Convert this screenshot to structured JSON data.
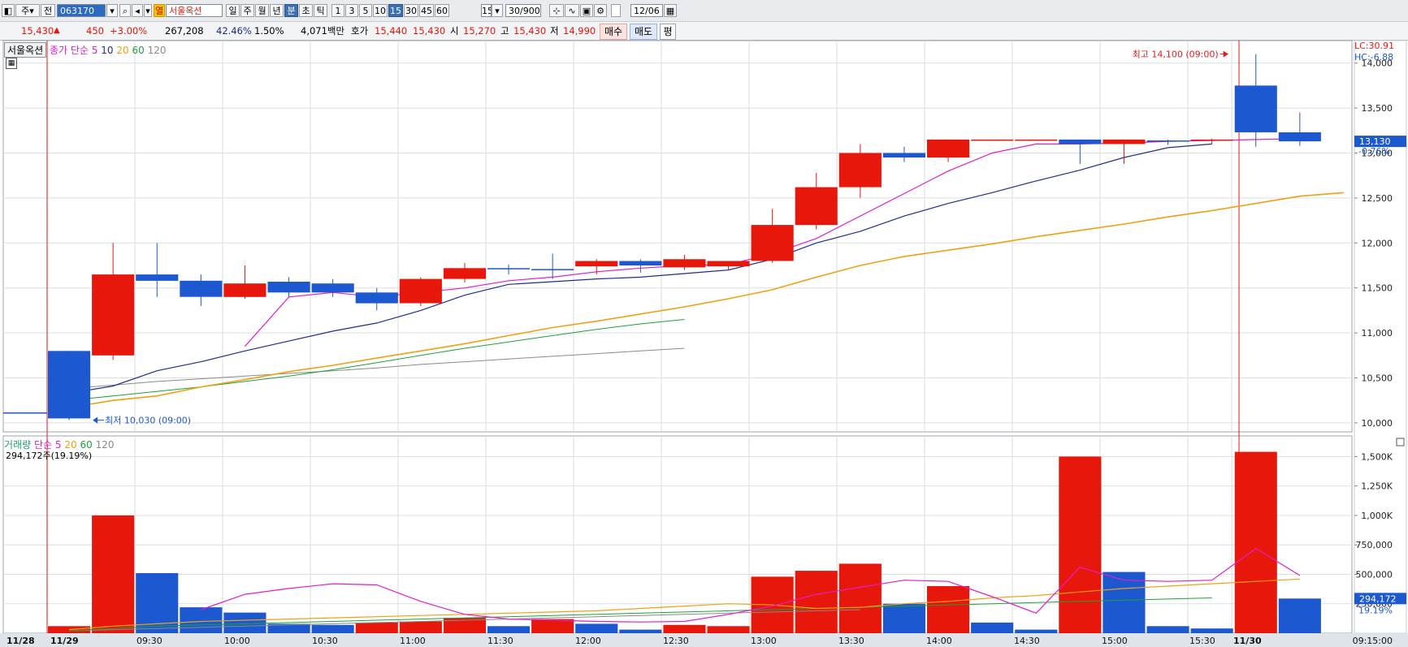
{
  "toolbar": {
    "market_btn": "주",
    "mode_btn": "전",
    "code_value": "063170",
    "name_tag": "열",
    "stock_name": "서울옥션",
    "period_tabs": [
      "일",
      "주",
      "월",
      "년",
      "분",
      "초",
      "틱"
    ],
    "period_selected": "분",
    "minute_tabs": [
      "1",
      "3",
      "5",
      "10",
      "15",
      "30",
      "45",
      "60"
    ],
    "minute_selected": "15",
    "minute_value": "15",
    "count_value": "30/900",
    "date_value": "12/06"
  },
  "quote": {
    "price": "15,430",
    "change_arrow": "▲",
    "change": "450",
    "change_pct": "+3.00%",
    "volume": "267,208",
    "vol_ratio": "42.46%",
    "turnover": "1.50%",
    "amount": "4,071백만",
    "hoga_label": "호가",
    "ask": "15,440",
    "bid": "15,430",
    "open_label": "시",
    "open": "15,270",
    "high_label": "고",
    "high": "15,430",
    "low_label": "저",
    "low": "14,990",
    "buy_btn": "매수",
    "sell_btn": "매도",
    "avg_btn": "평"
  },
  "price_legend": {
    "name": "서울옥션",
    "ma_label": "종가 단순",
    "periods": [
      "5",
      "10",
      "20",
      "60",
      "120"
    ]
  },
  "volume_legend": {
    "name": "거래량",
    "ma_label": "단순",
    "periods": [
      "5",
      "20",
      "60",
      "120"
    ],
    "current": "294,172주(19.19%)"
  },
  "annotations": {
    "high_text": "최고 14,100 (09:00)",
    "low_text": "최저 10,030 (09:00)",
    "lc": "LC:30.91",
    "hc": "HC:-6.88",
    "last_price": "13,130",
    "last_pct": "-0.76%",
    "last_volume": "294,172",
    "last_vol_pct": "19.19%"
  },
  "colors": {
    "up": "#e8170b",
    "down": "#1c58cf",
    "ma5": "#e21ec8",
    "ma10": "#1f2e8c",
    "ma20": "#f0a015",
    "ma60": "#1fa03a",
    "ma120": "#8a8a8a",
    "marker": "#e21a1a"
  },
  "chart_data": [
    {
      "type": "candlestick",
      "title": "서울옥션 15분",
      "x_labels": [
        "11/28",
        "11/29",
        "09:30",
        "10:00",
        "10:30",
        "11:00",
        "11:30",
        "12:00",
        "12:30",
        "13:00",
        "13:30",
        "14:00",
        "14:30",
        "15:00",
        "15:30",
        "11/30",
        "09:15:00"
      ],
      "y_ticks": [
        "10,000",
        "10,500",
        "11,000",
        "11,500",
        "12,000",
        "12,500",
        "13,000",
        "13,500",
        "14,000"
      ],
      "ylim": [
        9900,
        14250
      ],
      "candles": [
        {
          "o": 10800,
          "h": 10800,
          "l": 10030,
          "c": 10050
        },
        {
          "o": 10750,
          "h": 12000,
          "l": 10700,
          "c": 11650
        },
        {
          "o": 11650,
          "h": 12000,
          "l": 11400,
          "c": 11580
        },
        {
          "o": 11580,
          "h": 11650,
          "l": 11300,
          "c": 11400
        },
        {
          "o": 11400,
          "h": 11750,
          "l": 11380,
          "c": 11550
        },
        {
          "o": 11570,
          "h": 11620,
          "l": 11400,
          "c": 11450
        },
        {
          "o": 11550,
          "h": 11600,
          "l": 11400,
          "c": 11450
        },
        {
          "o": 11450,
          "h": 11500,
          "l": 11250,
          "c": 11330
        },
        {
          "o": 11330,
          "h": 11620,
          "l": 11300,
          "c": 11600
        },
        {
          "o": 11600,
          "h": 11780,
          "l": 11560,
          "c": 11720
        },
        {
          "o": 11720,
          "h": 11760,
          "l": 11650,
          "c": 11710
        },
        {
          "o": 11710,
          "h": 11880,
          "l": 11600,
          "c": 11700
        },
        {
          "o": 11740,
          "h": 11820,
          "l": 11650,
          "c": 11800
        },
        {
          "o": 11800,
          "h": 11820,
          "l": 11670,
          "c": 11750
        },
        {
          "o": 11730,
          "h": 11870,
          "l": 11700,
          "c": 11820
        },
        {
          "o": 11740,
          "h": 11800,
          "l": 11700,
          "c": 11800
        },
        {
          "o": 11800,
          "h": 12380,
          "l": 11780,
          "c": 12200
        },
        {
          "o": 12200,
          "h": 12780,
          "l": 12150,
          "c": 12620
        },
        {
          "o": 12620,
          "h": 13100,
          "l": 12500,
          "c": 13000
        },
        {
          "o": 13000,
          "h": 13070,
          "l": 12900,
          "c": 12950
        },
        {
          "o": 12950,
          "h": 13150,
          "l": 12900,
          "c": 13150
        },
        {
          "o": 13150,
          "h": 13150,
          "l": 13150,
          "c": 13150
        },
        {
          "o": 13150,
          "h": 13150,
          "l": 13150,
          "c": 13150
        },
        {
          "o": 13150,
          "h": 13150,
          "l": 12880,
          "c": 13100
        },
        {
          "o": 13100,
          "h": 13150,
          "l": 12880,
          "c": 13150
        },
        {
          "o": 13140,
          "h": 13150,
          "l": 13090,
          "c": 13130
        },
        {
          "o": 13140,
          "h": 13160,
          "l": 13100,
          "c": 13150
        },
        {
          "o": 13750,
          "h": 14100,
          "l": 13070,
          "c": 13230
        },
        {
          "o": 13230,
          "h": 13450,
          "l": 13080,
          "c": 13130
        }
      ],
      "ma5": [
        null,
        null,
        null,
        null,
        10850,
        11400,
        11450,
        11400,
        11450,
        11500,
        11580,
        11620,
        11680,
        11720,
        11750,
        11760,
        11880,
        12050,
        12300,
        12550,
        12800,
        13000,
        13100,
        13100,
        13110,
        13130,
        13140,
        13150,
        13160
      ],
      "ma10": [
        10330,
        10410,
        10580,
        10680,
        10800,
        10910,
        11020,
        11110,
        11250,
        11420,
        11540,
        11570,
        11600,
        11620,
        11660,
        11700,
        11820,
        12000,
        12130,
        12300,
        12440,
        12560,
        12690,
        12810,
        12950,
        13060,
        13100
      ],
      "ma20": [
        10170,
        10250,
        10300,
        10400,
        10480,
        10570,
        10640,
        10720,
        10800,
        10880,
        10970,
        11060,
        11130,
        11210,
        11290,
        11380,
        11480,
        11620,
        11750,
        11850,
        11920,
        11990,
        12070,
        12140,
        12210,
        12290,
        12360,
        12440,
        12520,
        12560
      ],
      "ma60": [
        10250,
        10300,
        10350,
        10400,
        10460,
        10520,
        10590,
        10670,
        10750,
        10830,
        10900,
        10970,
        11040,
        11100,
        11150
      ],
      "ma120": [
        10380,
        10420,
        10460,
        10490,
        10520,
        10550,
        10580,
        10610,
        10650,
        10680,
        10710,
        10740,
        10770,
        10800,
        10830
      ]
    },
    {
      "type": "bar",
      "title": "거래량",
      "y_ticks": [
        "250,000",
        "500,000",
        "750,000",
        "1,000K",
        "1,250K",
        "1,500K"
      ],
      "ylim": [
        0,
        1620000
      ],
      "values": [
        60000,
        1000000,
        510000,
        220000,
        175000,
        80000,
        70000,
        90000,
        100000,
        130000,
        60000,
        120000,
        80000,
        30000,
        70000,
        60000,
        480000,
        530000,
        590000,
        250000,
        400000,
        90000,
        30000,
        1500000,
        520000,
        60000,
        40000,
        1540000,
        294172
      ],
      "up": [
        true,
        true,
        false,
        false,
        false,
        false,
        false,
        true,
        true,
        true,
        false,
        true,
        false,
        false,
        true,
        true,
        true,
        true,
        true,
        false,
        true,
        false,
        false,
        true,
        false,
        false,
        false,
        true,
        false
      ],
      "ma5": [
        null,
        null,
        null,
        200000,
        330000,
        380000,
        420000,
        410000,
        270000,
        160000,
        120000,
        110000,
        100000,
        95000,
        100000,
        160000,
        230000,
        330000,
        390000,
        450000,
        440000,
        310000,
        170000,
        560000,
        450000,
        440000,
        450000,
        720000,
        490000
      ],
      "ma20": [
        30000,
        60000,
        80000,
        100000,
        110000,
        120000,
        130000,
        140000,
        150000,
        160000,
        170000,
        180000,
        190000,
        210000,
        230000,
        250000,
        240000,
        210000,
        220000,
        250000,
        270000,
        300000,
        320000,
        350000,
        380000,
        400000,
        420000,
        440000,
        460000
      ],
      "ma60": [
        20000,
        40000,
        60000,
        70000,
        80000,
        90000,
        100000,
        110000,
        120000,
        130000,
        140000,
        150000,
        160000,
        170000,
        180000,
        190000,
        200000,
        210000,
        220000,
        230000,
        240000,
        250000,
        260000,
        270000,
        280000,
        290000,
        300000
      ],
      "ma120": [
        20000,
        30000,
        40000,
        50000,
        60000,
        70000,
        80000,
        90000,
        100000,
        110000,
        120000,
        130000,
        140000,
        150000,
        160000,
        170000,
        180000,
        190000,
        200000
      ]
    }
  ]
}
